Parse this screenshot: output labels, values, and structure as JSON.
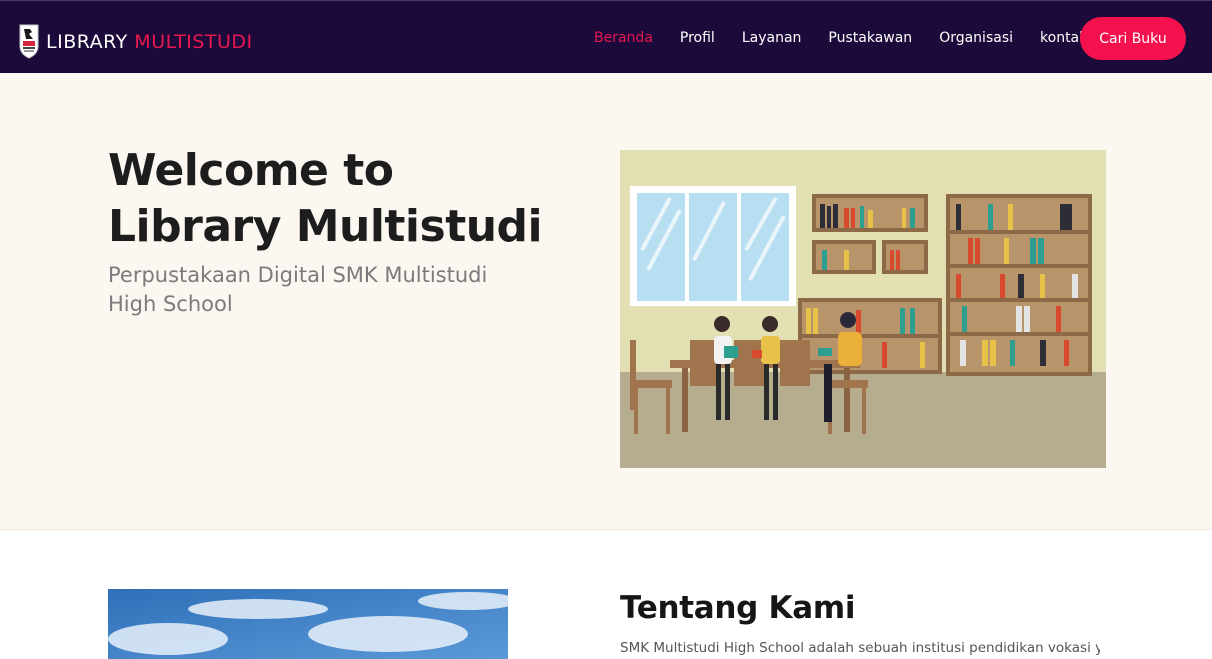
{
  "brand": {
    "name_part1": "LIBRARY",
    "name_part2": "MULTISTUDI",
    "logo_icon": "school-shield-logo"
  },
  "nav": {
    "items": [
      {
        "label": "Beranda",
        "active": true
      },
      {
        "label": "Profil",
        "active": false
      },
      {
        "label": "Layanan",
        "active": false
      },
      {
        "label": "Pustakawan",
        "active": false
      },
      {
        "label": "Organisasi",
        "active": false
      },
      {
        "label": "kontak",
        "active": false
      }
    ],
    "cta_label": "Cari Buku"
  },
  "hero": {
    "title": "Welcome to Library Multistudi",
    "subtitle": "Perpustakaan Digital SMK Multistudi High School",
    "illustration": "library-reading-room-illustration"
  },
  "about": {
    "title": "Tentang Kami",
    "text": "SMK Multistudi High School adalah sebuah institusi pendidikan vokasi yang",
    "photo": "sky-clouds-photo"
  },
  "colors": {
    "nav_bg": "#1c0a3a",
    "accent": "#e8174f",
    "cta": "#f5104e",
    "hero_bg": "#fcf7f1"
  }
}
